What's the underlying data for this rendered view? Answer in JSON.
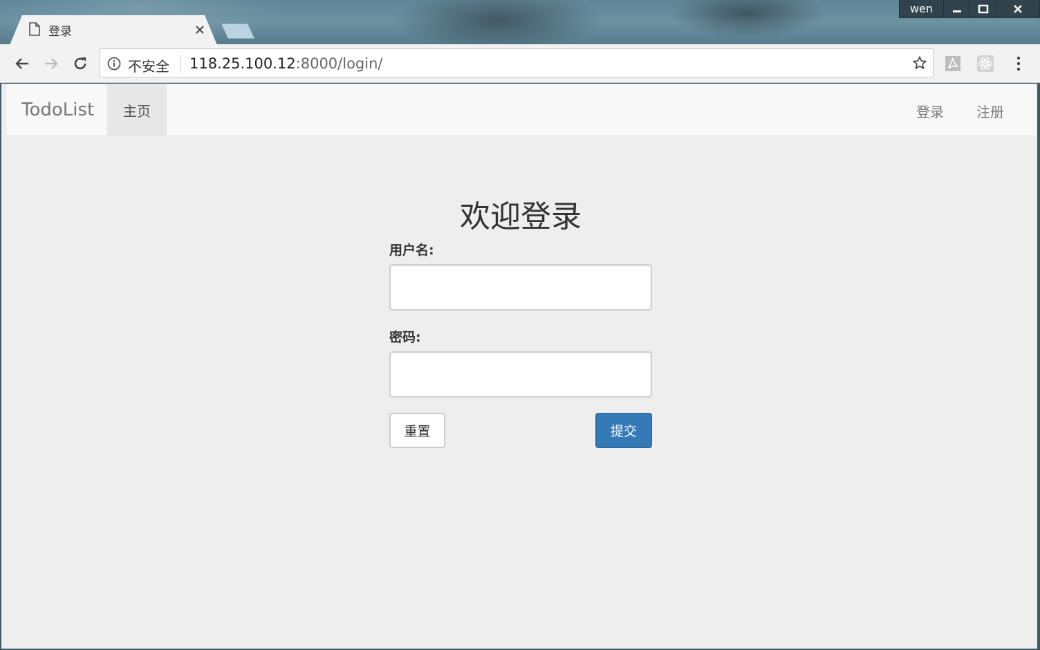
{
  "window": {
    "user": "wen"
  },
  "tab": {
    "title": "登录"
  },
  "omnibox": {
    "security": "不安全",
    "url_host": "118.25.100.12",
    "url_rest": ":8000/login/"
  },
  "navbar": {
    "brand": "TodoList",
    "home": "主页",
    "login": "登录",
    "register": "注册"
  },
  "form": {
    "title": "欢迎登录",
    "username_label": "用户名:",
    "username_value": "",
    "password_label": "密码:",
    "password_value": "",
    "reset_label": "重置",
    "submit_label": "提交"
  },
  "colors": {
    "primary": "#337ab7",
    "page_bg": "#eeeeee",
    "navbar_bg": "#f8f8f8"
  }
}
